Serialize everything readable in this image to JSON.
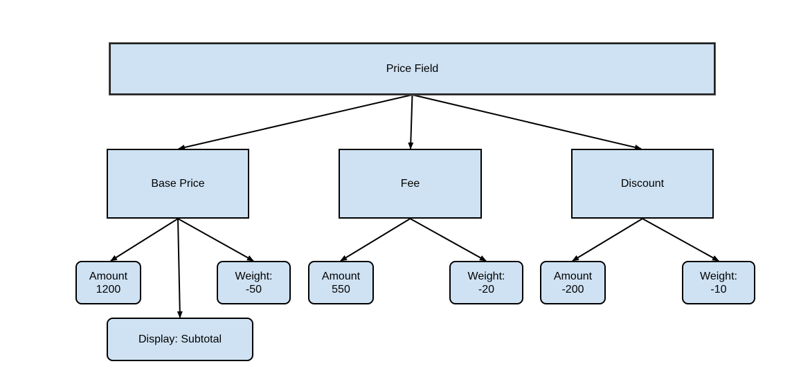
{
  "diagram": {
    "type": "tree",
    "colors": {
      "node_fill": "#cfe2f3",
      "node_border": "#000000",
      "edge": "#000000"
    },
    "nodes": [
      {
        "id": "price-field",
        "label": "Price Field",
        "shape": "rect"
      },
      {
        "id": "base-price",
        "label": "Base Price",
        "shape": "rect"
      },
      {
        "id": "fee",
        "label": "Fee",
        "shape": "rect"
      },
      {
        "id": "discount",
        "label": "Discount",
        "shape": "rect"
      },
      {
        "id": "base-amount",
        "label": "Amount\n1200",
        "shape": "rounded"
      },
      {
        "id": "base-display",
        "label": "Display: Subtotal",
        "shape": "rounded"
      },
      {
        "id": "base-weight",
        "label": "Weight:\n-50",
        "shape": "rounded"
      },
      {
        "id": "fee-amount",
        "label": "Amount\n550",
        "shape": "rounded"
      },
      {
        "id": "fee-weight",
        "label": "Weight:\n-20",
        "shape": "rounded"
      },
      {
        "id": "discount-amount",
        "label": "Amount\n-200",
        "shape": "rounded"
      },
      {
        "id": "discount-weight",
        "label": "Weight:\n-10",
        "shape": "rounded"
      }
    ],
    "edges": [
      {
        "from": "price-field",
        "to": "base-price"
      },
      {
        "from": "price-field",
        "to": "fee"
      },
      {
        "from": "price-field",
        "to": "discount"
      },
      {
        "from": "base-price",
        "to": "base-amount"
      },
      {
        "from": "base-price",
        "to": "base-display"
      },
      {
        "from": "base-price",
        "to": "base-weight"
      },
      {
        "from": "fee",
        "to": "fee-amount"
      },
      {
        "from": "fee",
        "to": "fee-weight"
      },
      {
        "from": "discount",
        "to": "discount-amount"
      },
      {
        "from": "discount",
        "to": "discount-weight"
      }
    ]
  }
}
